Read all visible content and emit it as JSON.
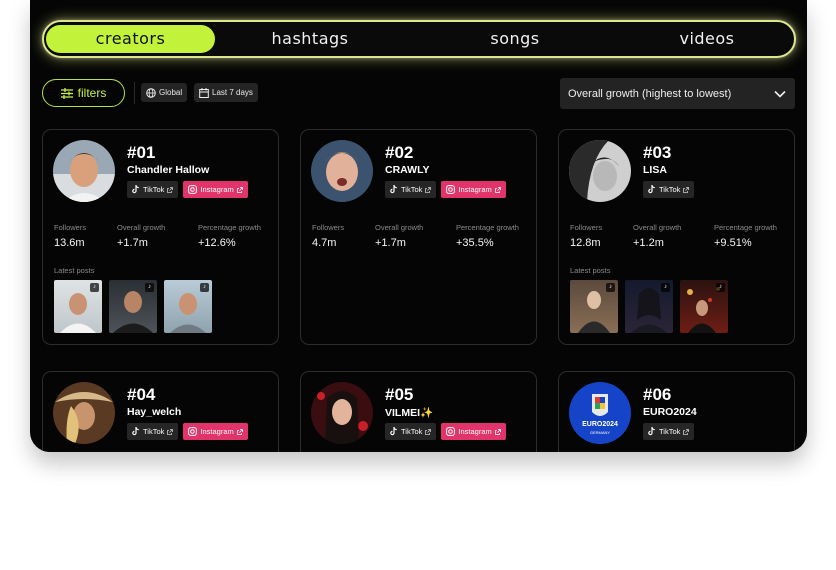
{
  "tabs": [
    {
      "label": "creators",
      "active": true
    },
    {
      "label": "hashtags",
      "active": false
    },
    {
      "label": "songs",
      "active": false
    },
    {
      "label": "videos",
      "active": false
    }
  ],
  "filters": {
    "button_label": "filters",
    "region_chip": "Global",
    "period_chip": "Last 7 days",
    "sort_value": "Overall growth (highest to lowest)"
  },
  "labels": {
    "followers": "Followers",
    "overall_growth": "Overall growth",
    "percentage_growth": "Percentage growth",
    "latest_posts": "Latest posts",
    "tiktok": "TikTok",
    "instagram": "Instagram"
  },
  "colors": {
    "accent": "#c3f23a",
    "instagram": "#e0346a"
  },
  "cards": [
    {
      "rank": "#01",
      "name": "Chandler Hallow",
      "instagram": true,
      "followers": "13.6m",
      "overall_growth": "+1.7m",
      "percentage_growth": "+12.6%",
      "has_posts": true
    },
    {
      "rank": "#02",
      "name": "CRAWLY",
      "instagram": true,
      "followers": "4.7m",
      "overall_growth": "+1.7m",
      "percentage_growth": "+35.5%",
      "has_posts": false
    },
    {
      "rank": "#03",
      "name": "LISA",
      "instagram": false,
      "followers": "12.8m",
      "overall_growth": "+1.2m",
      "percentage_growth": "+9.51%",
      "has_posts": true
    },
    {
      "rank": "#04",
      "name": "Hay_welch",
      "instagram": true
    },
    {
      "rank": "#05",
      "name": "VILMEI✨",
      "instagram": true
    },
    {
      "rank": "#06",
      "name": "EURO2024",
      "instagram": false,
      "avatar_text": "EURO2024",
      "avatar_subtext": "GERMANY"
    }
  ]
}
